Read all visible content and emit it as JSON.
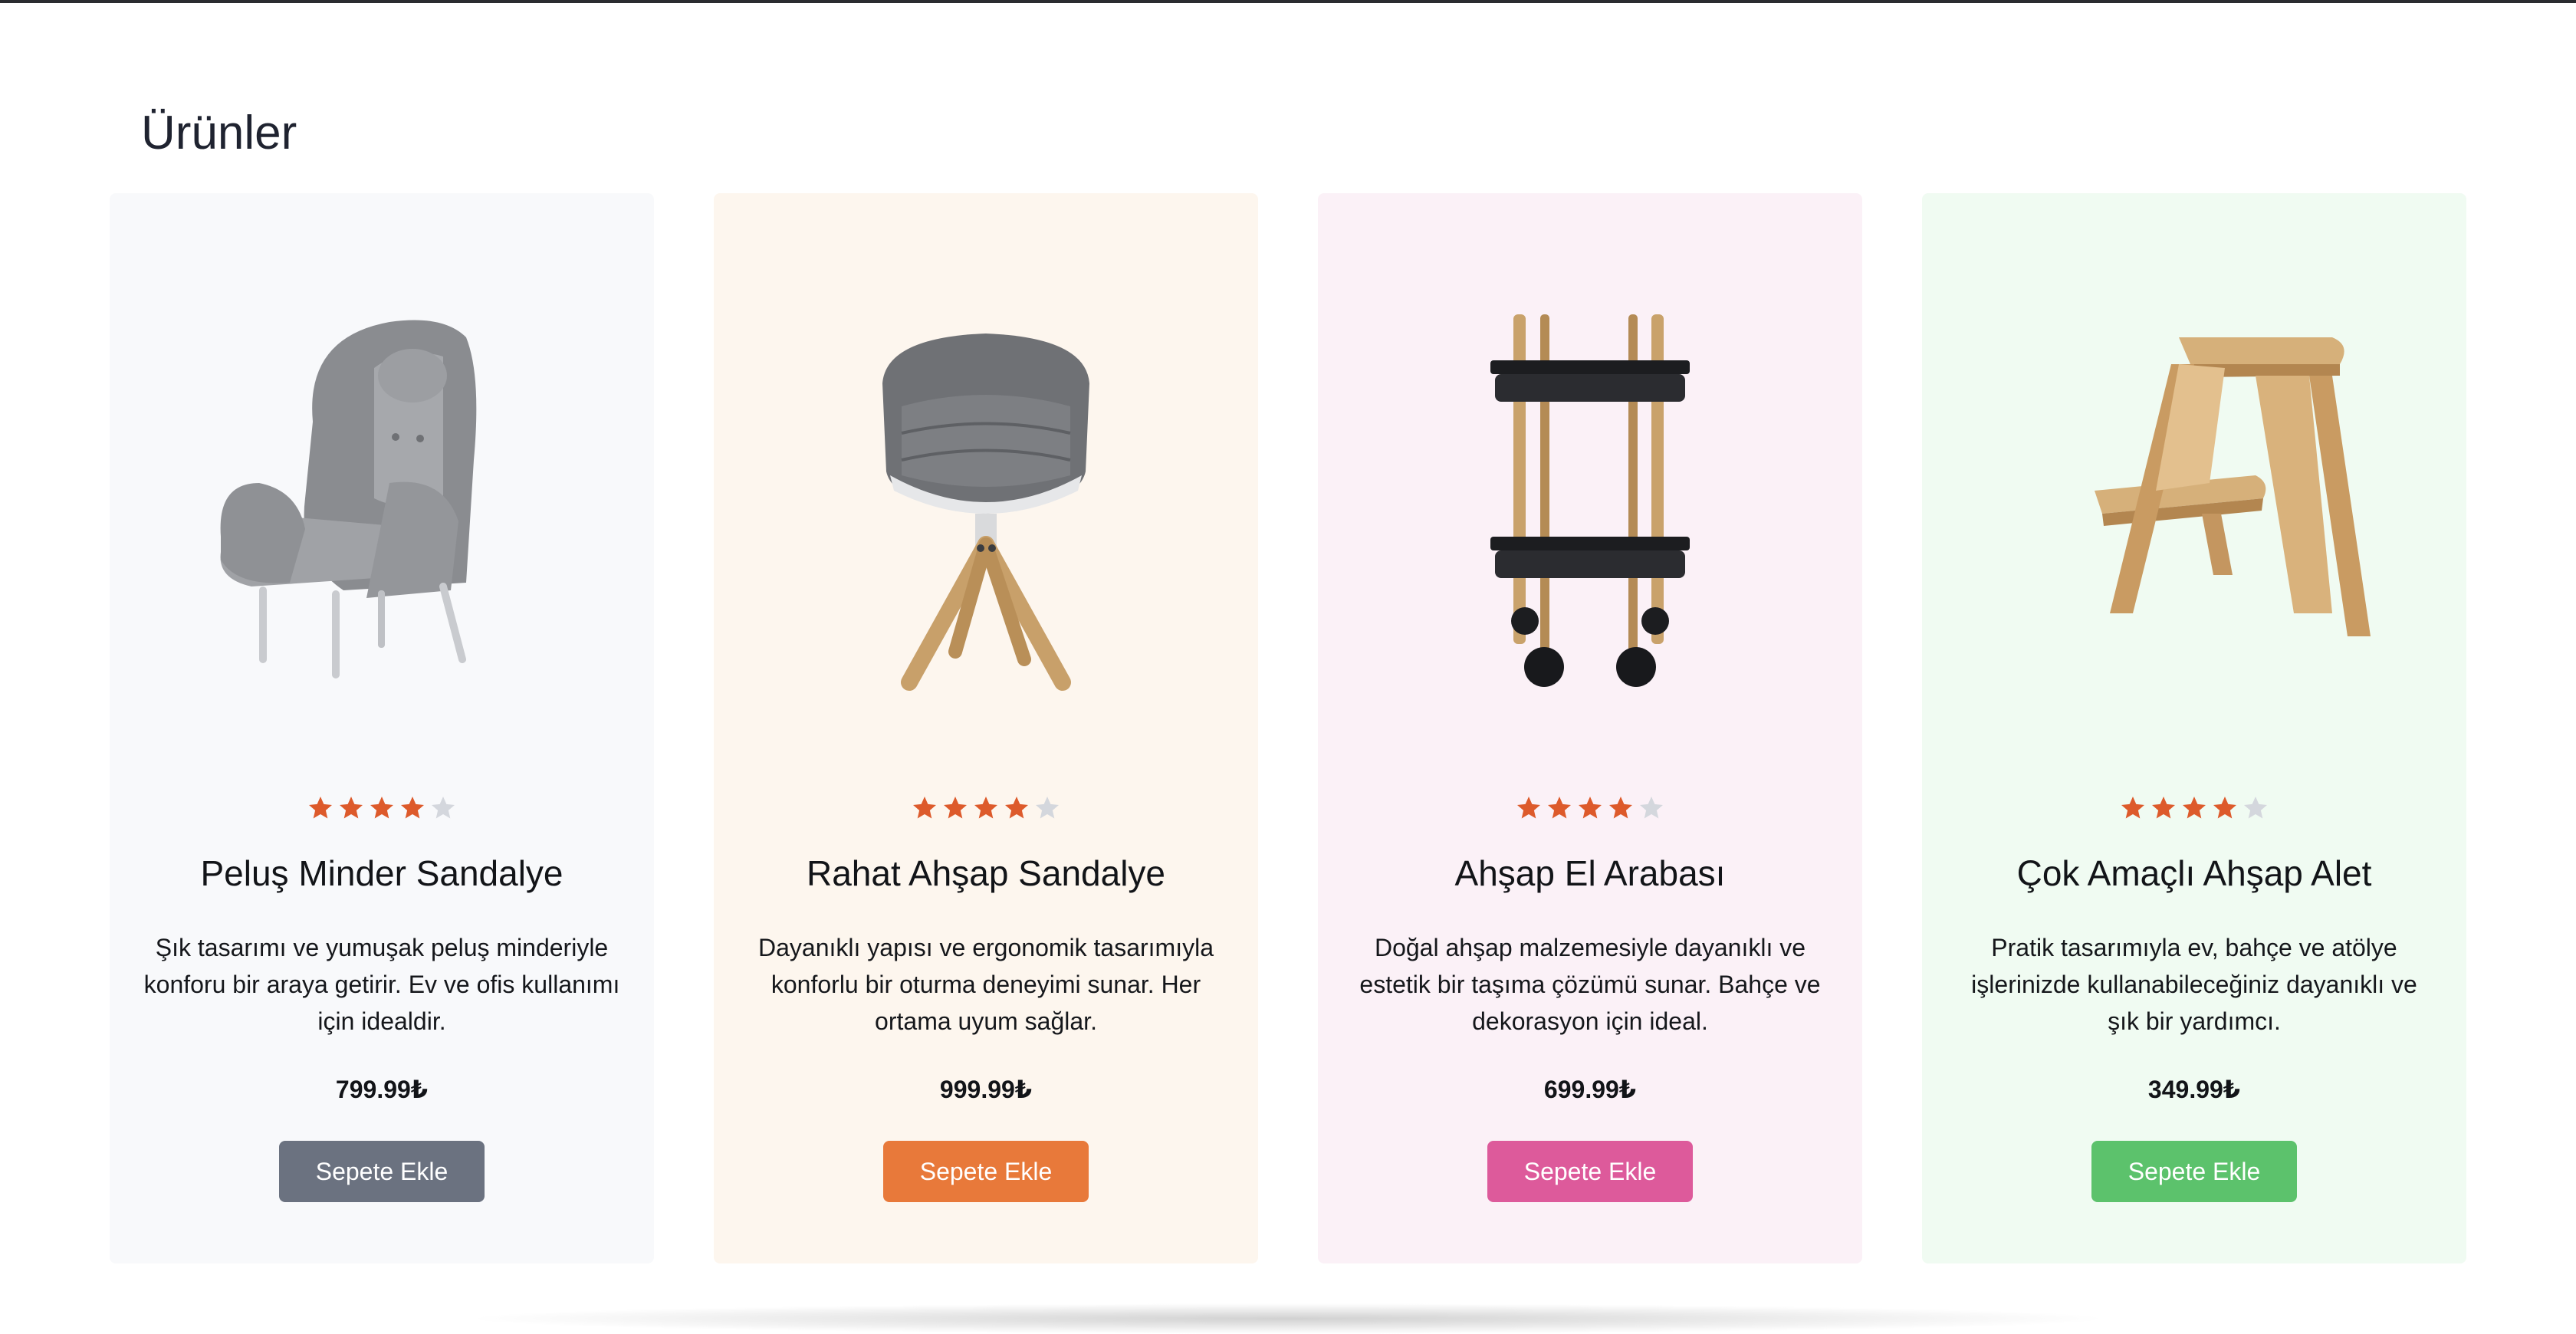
{
  "page": {
    "title": "Ürünler"
  },
  "products": [
    {
      "name": "Peluş Minder Sandalye",
      "description": "Şık tasarımı ve yumuşak peluş minderiyle konforu bir araya getirir. Ev ve ofis kullanımı için idealdir.",
      "price": "799.99₺",
      "rating": 4,
      "rating_max": 5,
      "button_label": "Sepete Ekle",
      "card_bg": "#f8f9fb",
      "button_color": "#6b7280",
      "image": "gray-lounge-armchair"
    },
    {
      "name": "Rahat Ahşap Sandalye",
      "description": "Dayanıklı yapısı ve ergonomik tasarımıyla konforlu bir oturma deneyimi sunar. Her ortama uyum sağlar.",
      "price": "999.99₺",
      "rating": 4,
      "rating_max": 5,
      "button_label": "Sepete Ekle",
      "card_bg": "#fdf6ee",
      "button_color": "#e8793a",
      "image": "upholstered-chair-wooden-legs"
    },
    {
      "name": "Ahşap El Arabası",
      "description": "Doğal ahşap malzemesiyle dayanıklı ve estetik bir taşıma çözümü sunar. Bahçe ve dekorasyon için ideal.",
      "price": "699.99₺",
      "rating": 4,
      "rating_max": 5,
      "button_label": "Sepete Ekle",
      "card_bg": "#fbf1f7",
      "button_color": "#dd5a9b",
      "image": "two-tier-rolling-cart"
    },
    {
      "name": "Çok Amaçlı Ahşap Alet",
      "description": "Pratik tasarımıyla ev, bahçe ve atölye işlerinizde kullanabileceğiniz dayanıklı ve şık bir yardımcı.",
      "price": "349.99₺",
      "rating": 4,
      "rating_max": 5,
      "button_label": "Sepete Ekle",
      "card_bg": "#f0fbf2",
      "button_color": "#5cc26c",
      "image": "wooden-step-stool"
    }
  ],
  "colors": {
    "star_filled": "#dd5a2b",
    "star_empty": "#d4d7dd"
  }
}
